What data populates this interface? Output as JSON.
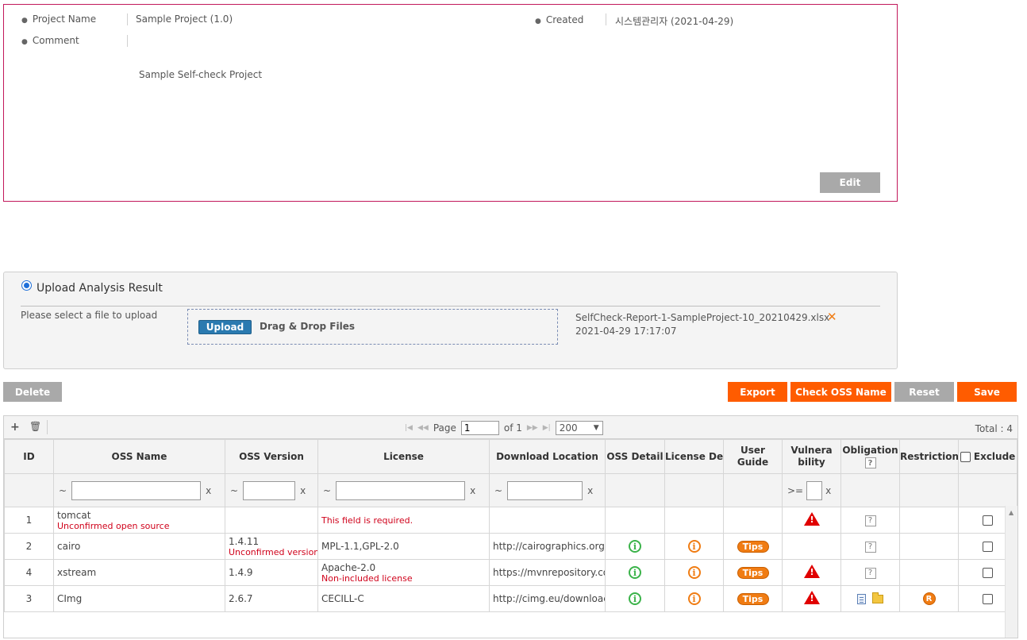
{
  "project": {
    "name_label": "Project Name",
    "name_value": "Sample Project (1.0)",
    "created_label": "Created",
    "created_value": "시스템관리자 (2021-04-29)",
    "comment_label": "Comment",
    "comment_value": "Sample Self-check Project",
    "edit_label": "Edit"
  },
  "upload": {
    "radio_label": "Upload Analysis Result",
    "instruction": "Please select a file to upload",
    "upload_btn": "Upload",
    "drop_text": "Drag & Drop Files",
    "file_name": "SelfCheck-Report-1-SampleProject-10_20210429.xlsx",
    "file_time": "2021-04-29 17:17:07"
  },
  "actions": {
    "delete": "Delete",
    "export": "Export",
    "check_oss": "Check OSS Name",
    "reset": "Reset",
    "save": "Save"
  },
  "pager": {
    "page_label": "Page",
    "page_value": "1",
    "of_label": "of 1",
    "rows_per_page": "200",
    "total": "Total : 4"
  },
  "columns": {
    "id": "ID",
    "oss_name": "OSS Name",
    "oss_version": "OSS Version",
    "license": "License",
    "download": "Download Location",
    "oss_detail": "OSS Detail",
    "license_detail": "License De",
    "user_guide_1": "User",
    "user_guide_2": "Guide",
    "vuln_1": "Vulnera",
    "vuln_2": "bility",
    "obligation": "Obligation",
    "restriction": "Restriction",
    "exclude": "Exclude"
  },
  "filters": {
    "tilde": "~",
    "clear": "x",
    "gte": ">="
  },
  "rows": [
    {
      "id": "1",
      "name": "tomcat",
      "name_note": "Unconfirmed open source",
      "version": "",
      "version_note": "",
      "license": "",
      "license_note": "This field is required.",
      "download": ""
    },
    {
      "id": "2",
      "name": "cairo",
      "name_note": "",
      "version": "1.4.11",
      "version_note": "Unconfirmed version",
      "license": "MPL-1.1,GPL-2.0",
      "license_note": "",
      "download": "http://cairographics.org/"
    },
    {
      "id": "4",
      "name": "xstream",
      "name_note": "",
      "version": "1.4.9",
      "version_note": "",
      "license": "Apache-2.0",
      "license_note": "Non-included license",
      "download": "https://mvnrepository.co"
    },
    {
      "id": "3",
      "name": "CImg",
      "name_note": "",
      "version": "2.6.7",
      "version_note": "",
      "license": "CECILL-C",
      "license_note": "",
      "download": "http://cimg.eu/downloac"
    }
  ],
  "labels": {
    "tips": "Tips",
    "info_glyph": "i",
    "question_glyph": "?",
    "restriction_glyph": "R"
  },
  "colors": {
    "accent_orange": "#ff5c00",
    "project_border": "#c2185b",
    "error_red": "#d0021b",
    "upload_blue": "#2a7ab0"
  }
}
